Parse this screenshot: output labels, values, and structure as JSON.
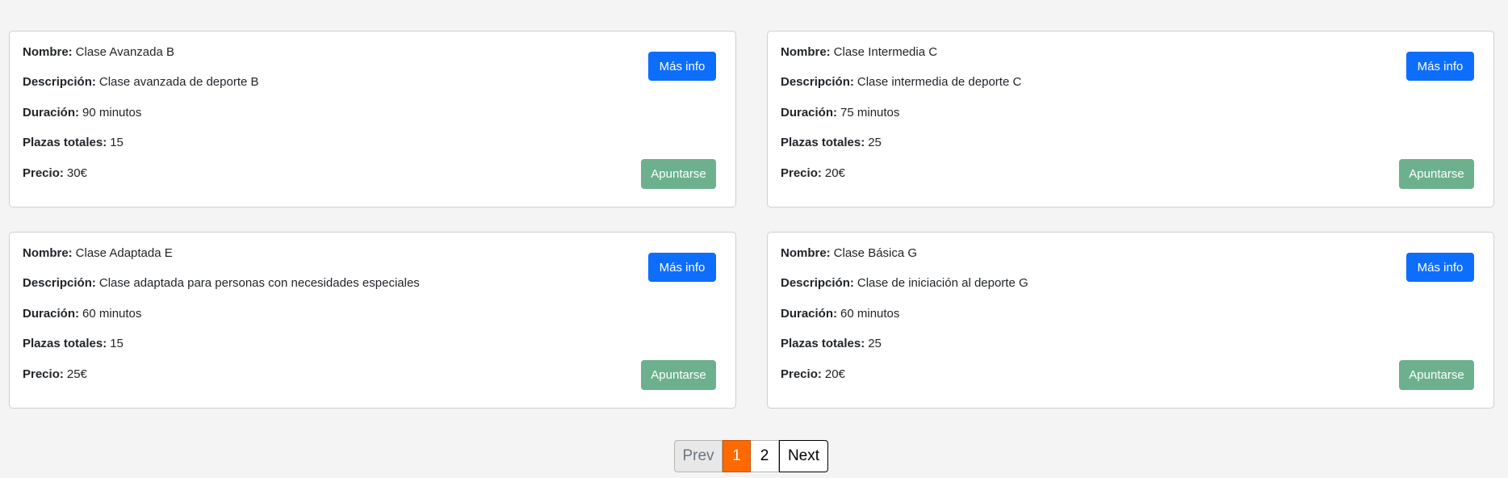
{
  "labels": {
    "name": "Nombre:",
    "description": "Descripción:",
    "duration": "Duración:",
    "seats": "Plazas totales:",
    "price": "Precio:",
    "info_button": "Más info",
    "join_button": "Apuntarse"
  },
  "classes": [
    {
      "name": "Clase Avanzada B",
      "description": "Clase avanzada de deporte B",
      "duration": "90 minutos",
      "seats": "15",
      "price": "30€"
    },
    {
      "name": "Clase Intermedia C",
      "description": "Clase intermedia de deporte C",
      "duration": "75 minutos",
      "seats": "25",
      "price": "20€"
    },
    {
      "name": "Clase Adaptada E",
      "description": "Clase adaptada para personas con necesidades especiales",
      "duration": "60 minutos",
      "seats": "15",
      "price": "25€"
    },
    {
      "name": "Clase Básica G",
      "description": "Clase de iniciación al deporte G",
      "duration": "60 minutos",
      "seats": "25",
      "price": "20€"
    }
  ],
  "pagination": {
    "prev_label": "Prev",
    "pages": [
      "1",
      "2"
    ],
    "current_page": "1",
    "next_label": "Next"
  },
  "colors": {
    "info_button": "#0d6efd",
    "join_button": "#6cb08e",
    "active_page": "#ff6a00",
    "background": "#f4f4f4"
  }
}
